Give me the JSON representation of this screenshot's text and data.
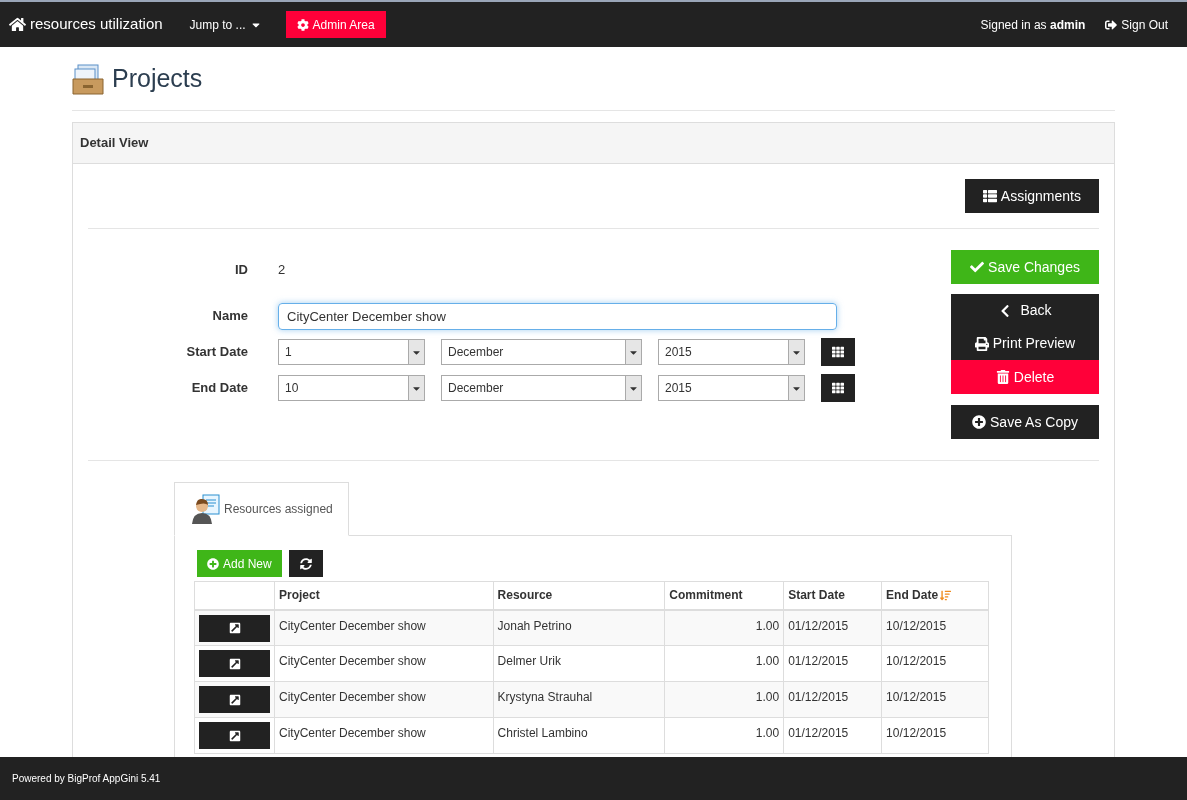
{
  "navbar": {
    "brand": "resources utilization",
    "jump": "Jump to ...",
    "admin": "Admin Area",
    "signed_in": "Signed in as **admin**",
    "sign_out": "Sign Out"
  },
  "page_title": "Projects",
  "panel": {
    "title": "Detail View",
    "assignments_button": "Assignments",
    "fields": [
      {
        "kind": "text",
        "label": "ID",
        "value": "2"
      },
      {
        "kind": "input",
        "label": "Name",
        "value": "CityCenter December show"
      },
      {
        "kind": "date",
        "label": "Start Date",
        "day": "1",
        "month": "December",
        "year": "2015"
      },
      {
        "kind": "date",
        "label": "End Date",
        "day": "10",
        "month": "December",
        "year": "2015"
      }
    ],
    "actions": {
      "save": "Save Changes",
      "back": "Back",
      "print": "Print Preview",
      "delete": "Delete",
      "copy": "Save As Copy"
    }
  },
  "tabs": [
    {
      "label": "Resources assigned",
      "selected": true
    }
  ],
  "child_table": {
    "add_new": "Add New",
    "columns": [
      {
        "label": "Project",
        "sorted": false
      },
      {
        "label": "Resource",
        "sorted": false
      },
      {
        "label": "Commitment",
        "sorted": false
      },
      {
        "label": "Start Date",
        "sorted": false
      },
      {
        "label": "End Date",
        "sorted": true
      }
    ],
    "rows": [
      [
        "CityCenter December show",
        "Jonah Petrino",
        "1.00",
        "01/12/2015",
        "10/12/2015"
      ],
      [
        "CityCenter December show",
        "Delmer Urik",
        "1.00",
        "01/12/2015",
        "10/12/2015"
      ],
      [
        "CityCenter December show",
        "Krystyna Strauhal",
        "1.00",
        "01/12/2015",
        "10/12/2015"
      ],
      [
        "CityCenter December show",
        "Christel Lambino",
        "1.00",
        "01/12/2015",
        "10/12/2015"
      ]
    ]
  },
  "footer": "Powered by BigProf AppGini 5.41"
}
